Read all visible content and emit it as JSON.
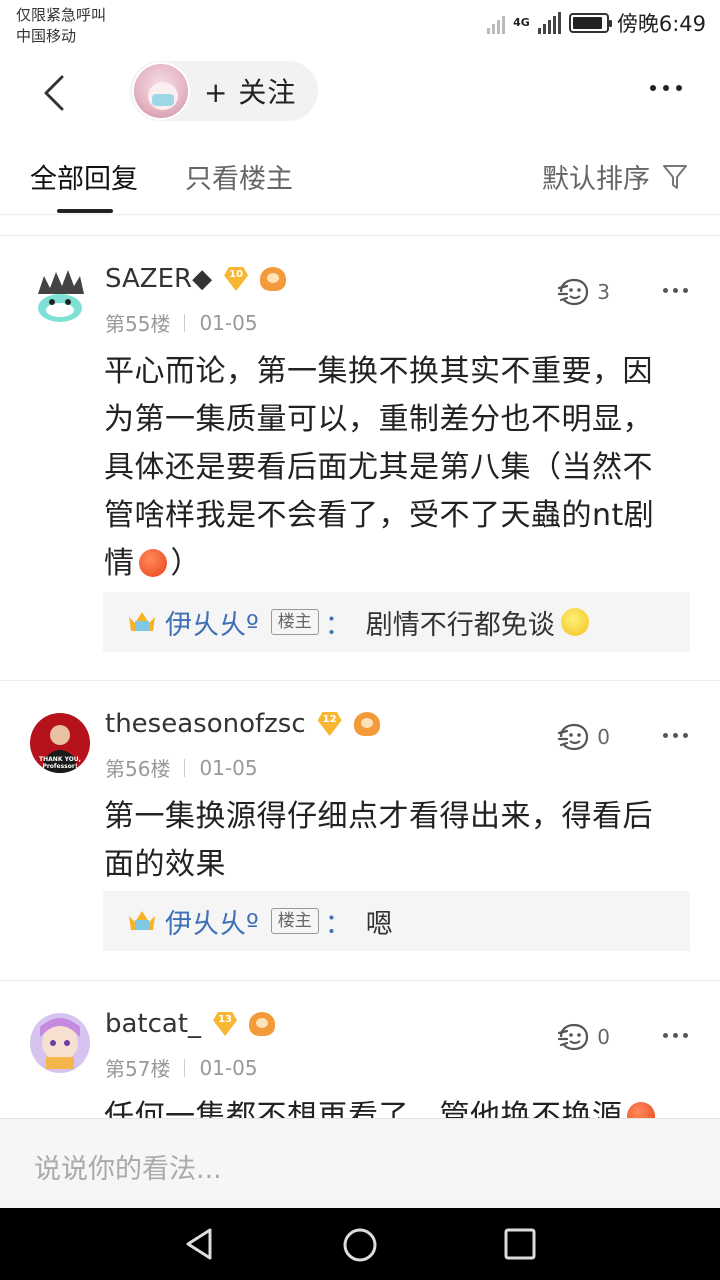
{
  "status": {
    "line1": "仅限紧急呼叫",
    "line2": "中国移动",
    "network": "4G",
    "time": "傍晚6:49",
    "battery_level": 0.8
  },
  "topnav": {
    "back_icon": "chevron-left-icon",
    "follow_label": "+ 关注",
    "more_icon": "more-horizontal-icon"
  },
  "tabs": {
    "all": "全部回复",
    "op_only": "只看楼主",
    "sort": "默认排序",
    "filter_icon": "filter-icon"
  },
  "posts": [
    {
      "username": "SAZER◆",
      "level": "10",
      "floor": "第55楼",
      "date": "01-05",
      "likes": "3",
      "content_lines": [
        "平心而论，第一集换不换其实不重要，因",
        "为第一集质量可以，重制差分也不明显，",
        "具体还是要看后面尤其是第八集（当然不",
        "管啥样我是不会看了，受不了天蟲的nt剧"
      ],
      "content_tail_pre": "情",
      "content_tail_post": "）",
      "reply": {
        "name": "伊乆乆º",
        "tag": "楼主",
        "colon": "：",
        "text": "剧情不行都免谈"
      }
    },
    {
      "username": "theseasonofzsc",
      "level": "12",
      "floor": "第56楼",
      "date": "01-05",
      "likes": "0",
      "content_lines": [
        "第一集换源得仔细点才看得出来，得看后",
        "面的效果"
      ],
      "avatar_text": "THANK YOU, Professor!",
      "reply": {
        "name": "伊乆乆º",
        "tag": "楼主",
        "colon": "：",
        "text": "嗯"
      }
    },
    {
      "username": "batcat_",
      "level": "13",
      "floor": "第57楼",
      "date": "01-05",
      "likes": "0",
      "content_partial": "任何一集都不想再看了，管他换不换源"
    }
  ],
  "input": {
    "placeholder": "说说你的看法..."
  },
  "navbar": {
    "back": "nav-back-icon",
    "home": "nav-home-icon",
    "recent": "nav-recent-icon"
  },
  "colors": {
    "link_blue": "#3f6fb5",
    "level_gold": "#f7b733",
    "navbar_bg": "#000000"
  }
}
